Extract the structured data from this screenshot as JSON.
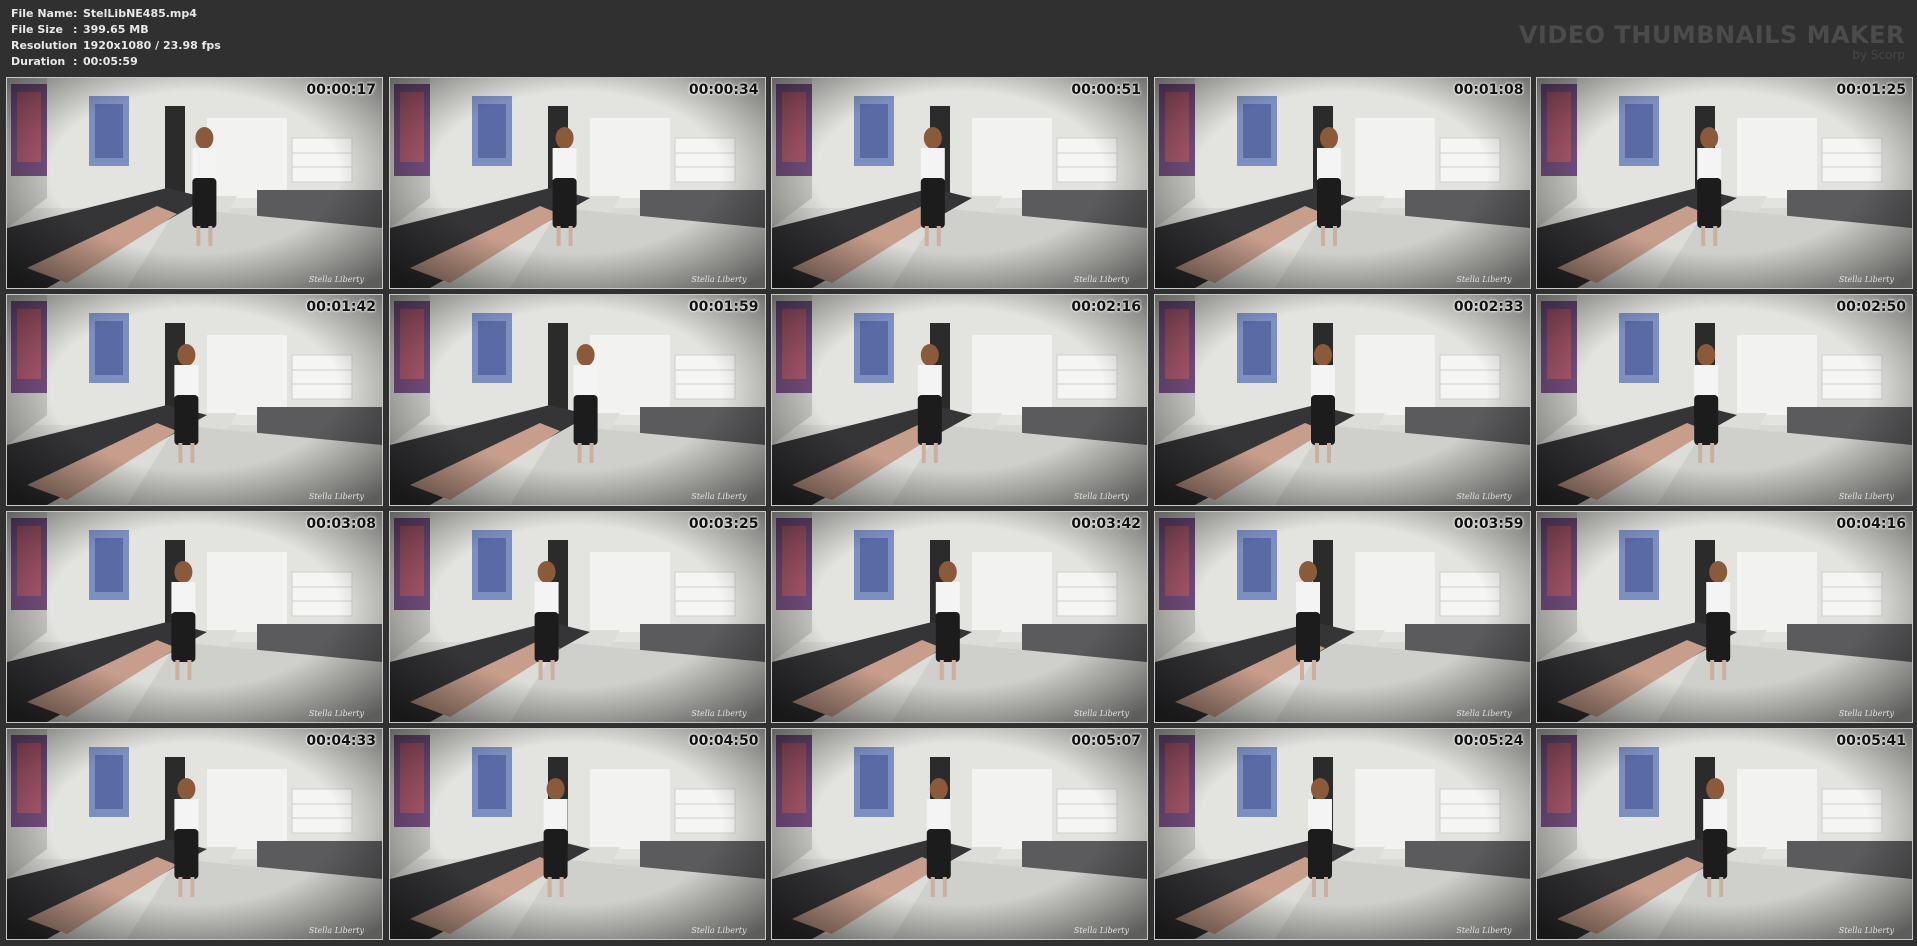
{
  "meta": {
    "file_name_label": "File Name",
    "file_name": "StelLibNE485.mp4",
    "file_size_label": "File Size",
    "file_size": "399.65 MB",
    "resolution_label": "Resolution",
    "resolution": "1920x1080 / 23.98 fps",
    "duration_label": "Duration",
    "duration": "00:05:59",
    "separator": ":"
  },
  "logo": {
    "title": "VIDEO THUMBNAILS MAKER",
    "subtitle": "by Scorp"
  },
  "watermark": "Stella Liberty",
  "thumbnails": [
    {
      "timestamp": "00:00:17"
    },
    {
      "timestamp": "00:00:34"
    },
    {
      "timestamp": "00:00:51"
    },
    {
      "timestamp": "00:01:08"
    },
    {
      "timestamp": "00:01:25"
    },
    {
      "timestamp": "00:01:42"
    },
    {
      "timestamp": "00:01:59"
    },
    {
      "timestamp": "00:02:16"
    },
    {
      "timestamp": "00:02:33"
    },
    {
      "timestamp": "00:02:50"
    },
    {
      "timestamp": "00:03:08"
    },
    {
      "timestamp": "00:03:25"
    },
    {
      "timestamp": "00:03:42"
    },
    {
      "timestamp": "00:03:59"
    },
    {
      "timestamp": "00:04:16"
    },
    {
      "timestamp": "00:04:33"
    },
    {
      "timestamp": "00:04:50"
    },
    {
      "timestamp": "00:05:07"
    },
    {
      "timestamp": "00:05:24"
    },
    {
      "timestamp": "00:05:41"
    }
  ]
}
